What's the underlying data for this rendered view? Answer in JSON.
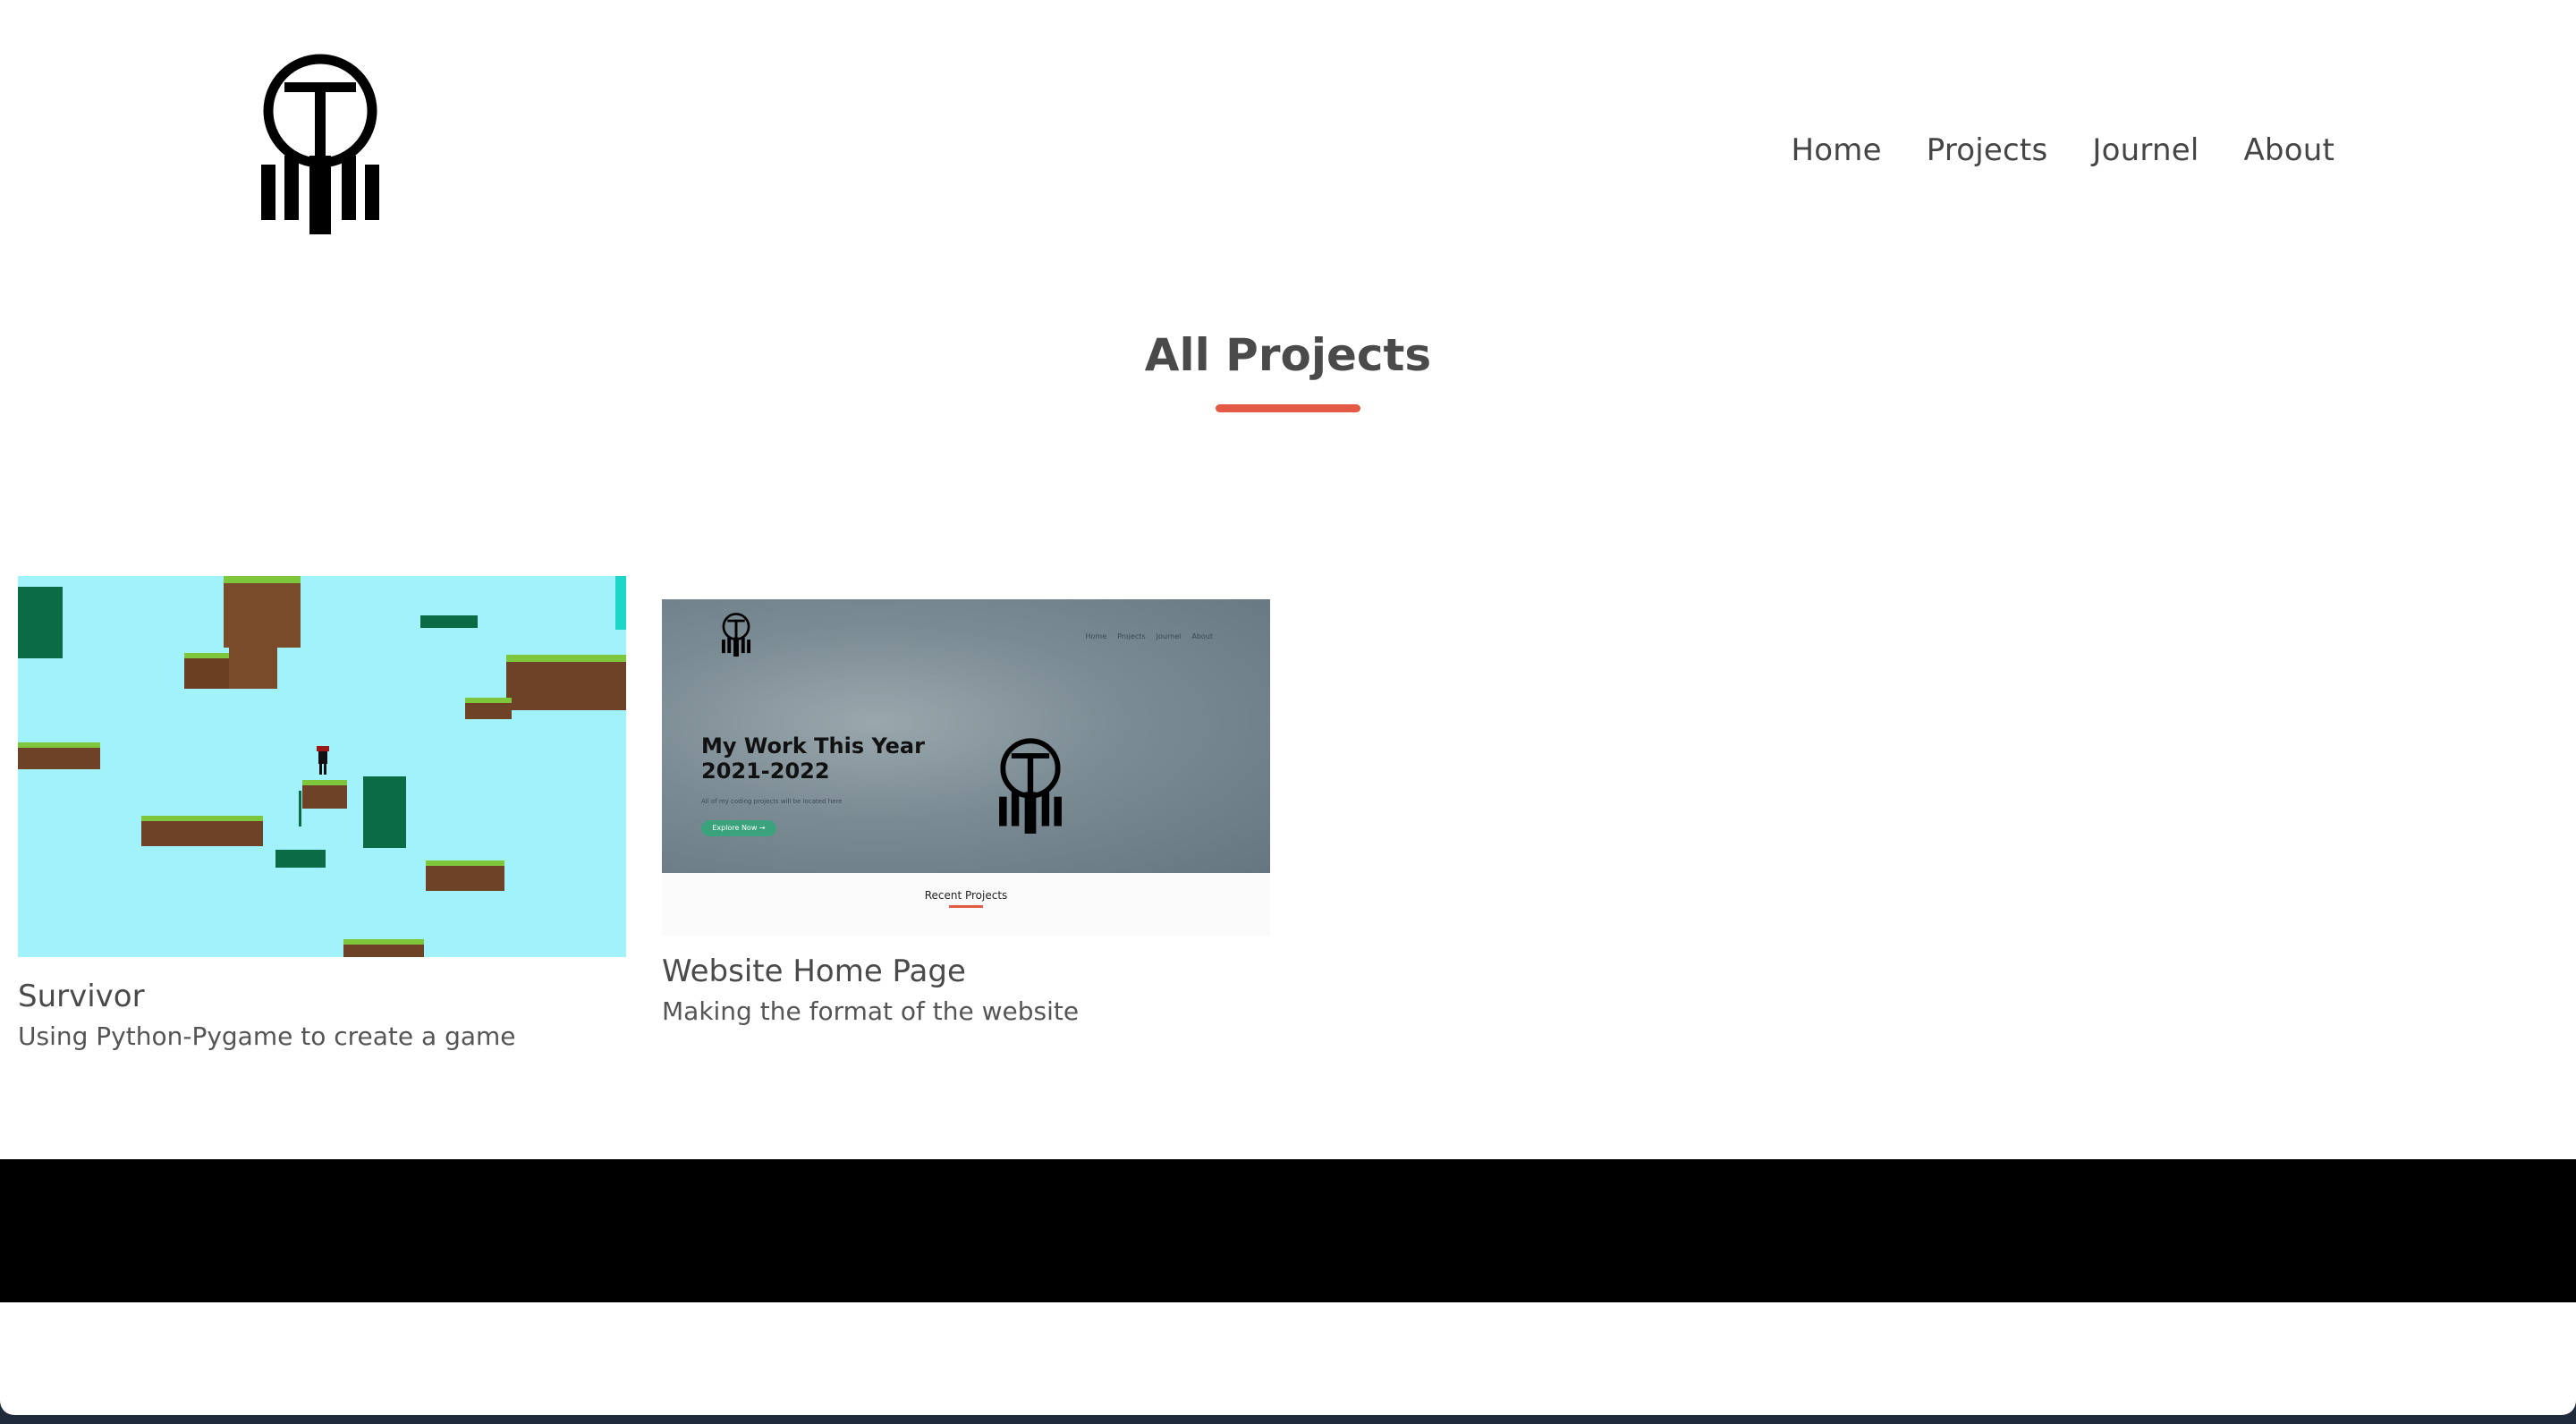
{
  "nav": {
    "items": [
      {
        "label": "Home"
      },
      {
        "label": "Projects"
      },
      {
        "label": "Journel"
      },
      {
        "label": "About"
      }
    ]
  },
  "main": {
    "heading": "All Projects"
  },
  "projects": [
    {
      "title": "Survivor",
      "description": "Using Python-Pygame to create a game"
    },
    {
      "title": "Website Home Page",
      "description": "Making the format of the website",
      "preview": {
        "nav": [
          "Home",
          "Projects",
          "Journel",
          "About"
        ],
        "hero_title": "My Work This Year 2021-2022",
        "hero_sub": "All of my coding projects will be located here",
        "button_label": "Explore Now →",
        "section_label": "Recent Projects"
      }
    }
  ],
  "colors": {
    "accent": "#e35b45",
    "footer": "#000000",
    "game_sky": "#a2f2fb",
    "button_green": "#3aa27d"
  },
  "icons": {
    "logo": "t-circle-logo-icon"
  }
}
